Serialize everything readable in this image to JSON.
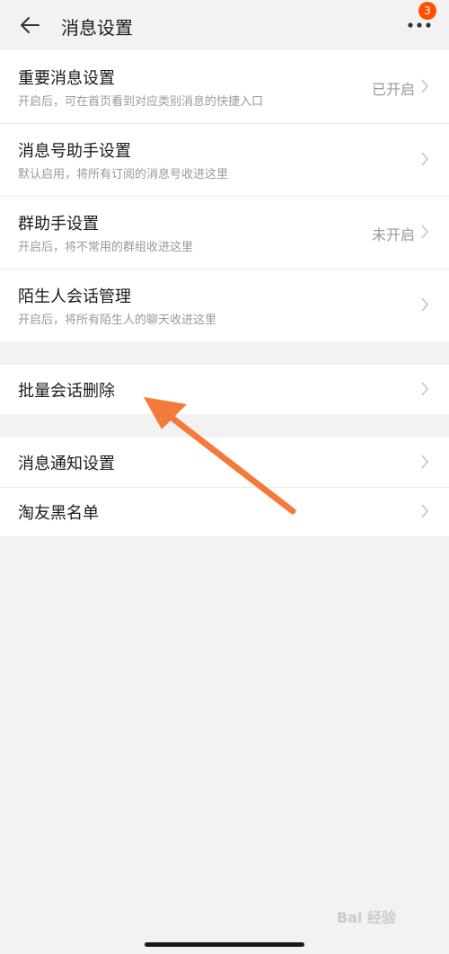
{
  "header": {
    "title": "消息设置",
    "badge_count": "3"
  },
  "group1": [
    {
      "label": "重要消息设置",
      "sub": "开启后，可在首页看到对应类别消息的快捷入口",
      "status": "已开启"
    },
    {
      "label": "消息号助手设置",
      "sub": "默认启用，将所有订阅的消息号收进这里",
      "status": ""
    },
    {
      "label": "群助手设置",
      "sub": "开启后，将不常用的群组收进这里",
      "status": "未开启"
    },
    {
      "label": "陌生人会话管理",
      "sub": "开启后，将所有陌生人的聊天收进这里",
      "status": ""
    }
  ],
  "group2": [
    {
      "label": "批量会话删除"
    }
  ],
  "group3": [
    {
      "label": "消息通知设置"
    },
    {
      "label": "淘友黑名单"
    }
  ],
  "annotation": {
    "arrow_color": "#f47a3c"
  },
  "watermark": "Bai 经验",
  "colors": {
    "badge": "#ff5000",
    "background": "#f2f2f2"
  }
}
